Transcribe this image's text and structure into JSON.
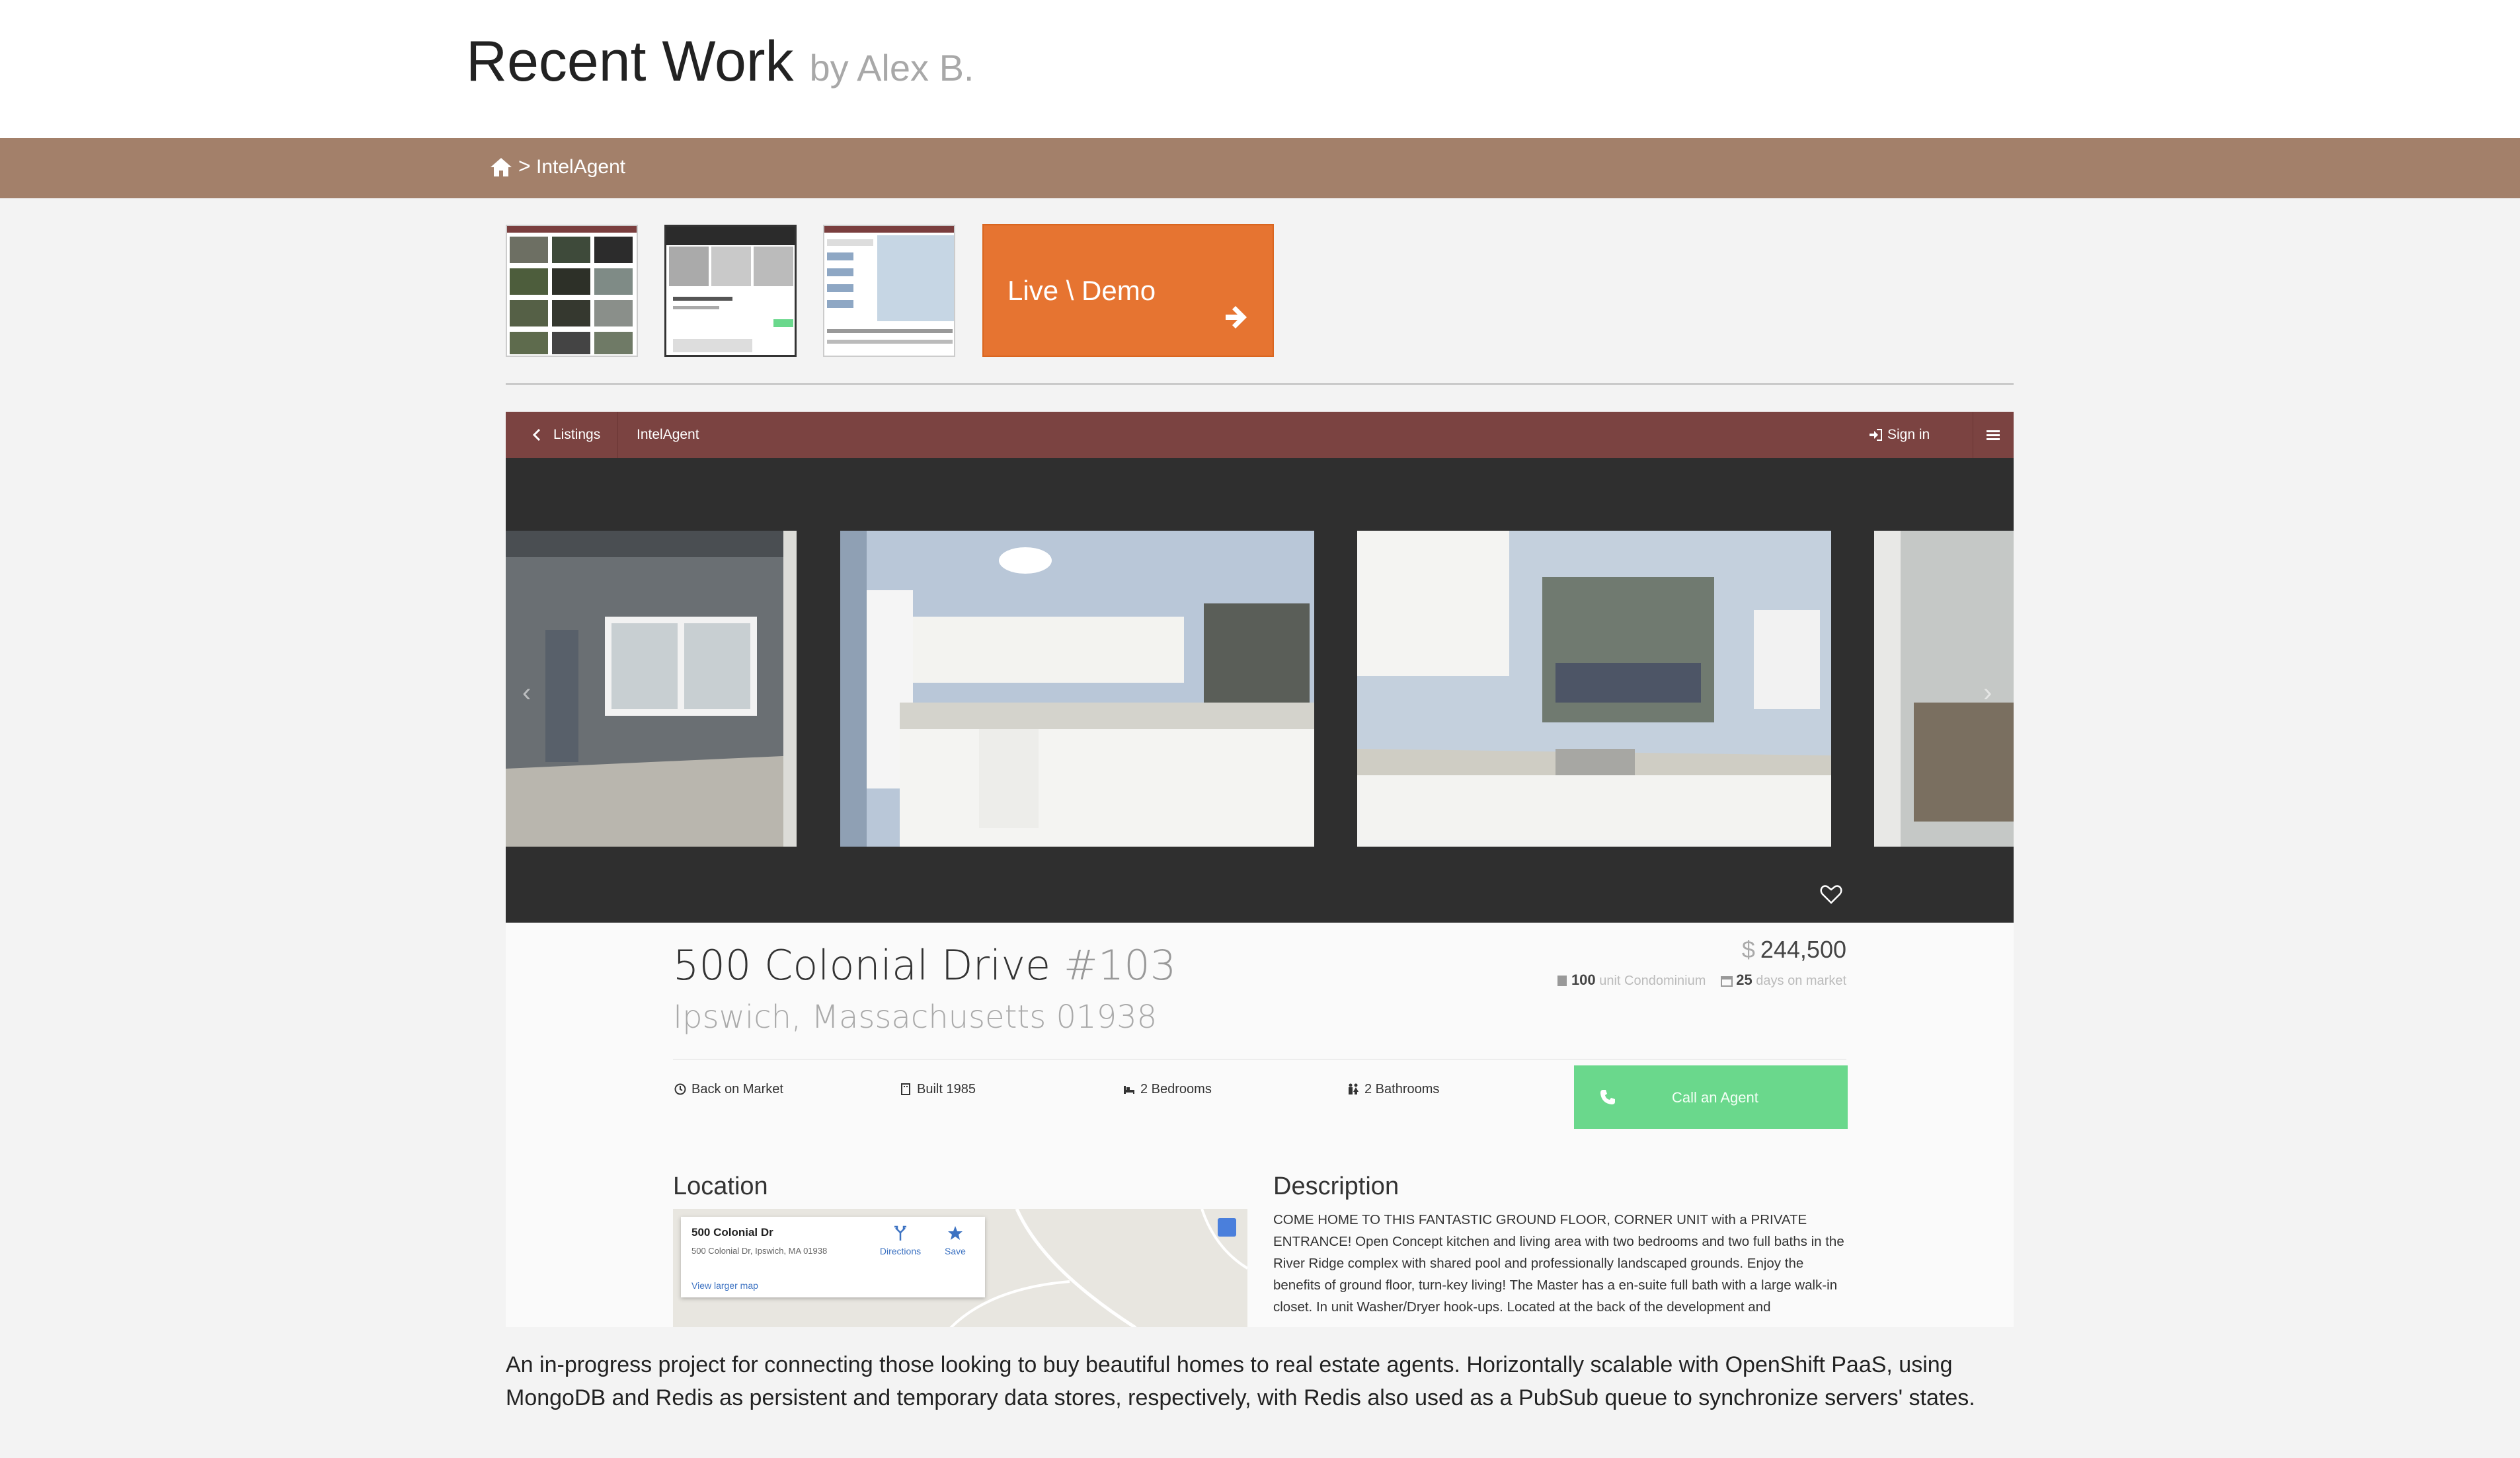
{
  "header": {
    "title": "Recent Work",
    "subtitle": "by Alex B."
  },
  "breadcrumb": {
    "home_icon": "home-icon",
    "separator": ">",
    "current": "IntelAgent"
  },
  "demo": {
    "label": "Live \\ Demo",
    "icon": "arrow-right-icon",
    "color": "#e67431"
  },
  "preview": {
    "nav": {
      "back_label": "Listings",
      "app_name": "IntelAgent",
      "signin_label": "Sign in",
      "menu_icon": "hamburger-icon",
      "color": "#7b4341"
    },
    "gallery": {
      "prev": "‹",
      "next": "›",
      "favorite_icon": "heart-icon"
    },
    "listing": {
      "street": "500 Colonial Drive",
      "unit": "#103",
      "city": "Ipswich, Massachusetts 01938",
      "currency": "$",
      "price": "244,500",
      "unit_count": "100",
      "unit_type": "unit Condominium",
      "days": "25",
      "days_label": "days on market",
      "facts": {
        "status": "Back on Market",
        "built": "Built 1985",
        "bedrooms": "2 Bedrooms",
        "bathrooms": "2 Bathrooms"
      },
      "call_label": "Call an Agent",
      "call_color": "#6ad88c"
    },
    "location": {
      "title": "Location",
      "map_name": "500 Colonial Dr",
      "map_address": "500 Colonial Dr, Ipswich, MA 01938",
      "directions": "Directions",
      "save": "Save",
      "larger_map": "View larger map"
    },
    "description": {
      "title": "Description",
      "text": "COME HOME TO THIS FANTASTIC GROUND FLOOR, CORNER UNIT with a PRIVATE ENTRANCE! Open Concept kitchen and living area with two bedrooms and two full baths in the River Ridge complex with shared pool and professionally landscaped grounds. Enjoy the benefits of ground floor, turn-key living! The Master has a en-suite full bath with a large walk-in closet. In unit Washer/Dryer hook-ups. Located at the back of the development and"
    }
  },
  "caption": "An in-progress project for connecting those looking to buy beautiful homes to real estate agents. Horizontally scalable with OpenShift PaaS, using MongoDB and Redis as persistent and temporary data stores, respectively, with Redis also used as a PubSub queue to synchronize servers' states."
}
